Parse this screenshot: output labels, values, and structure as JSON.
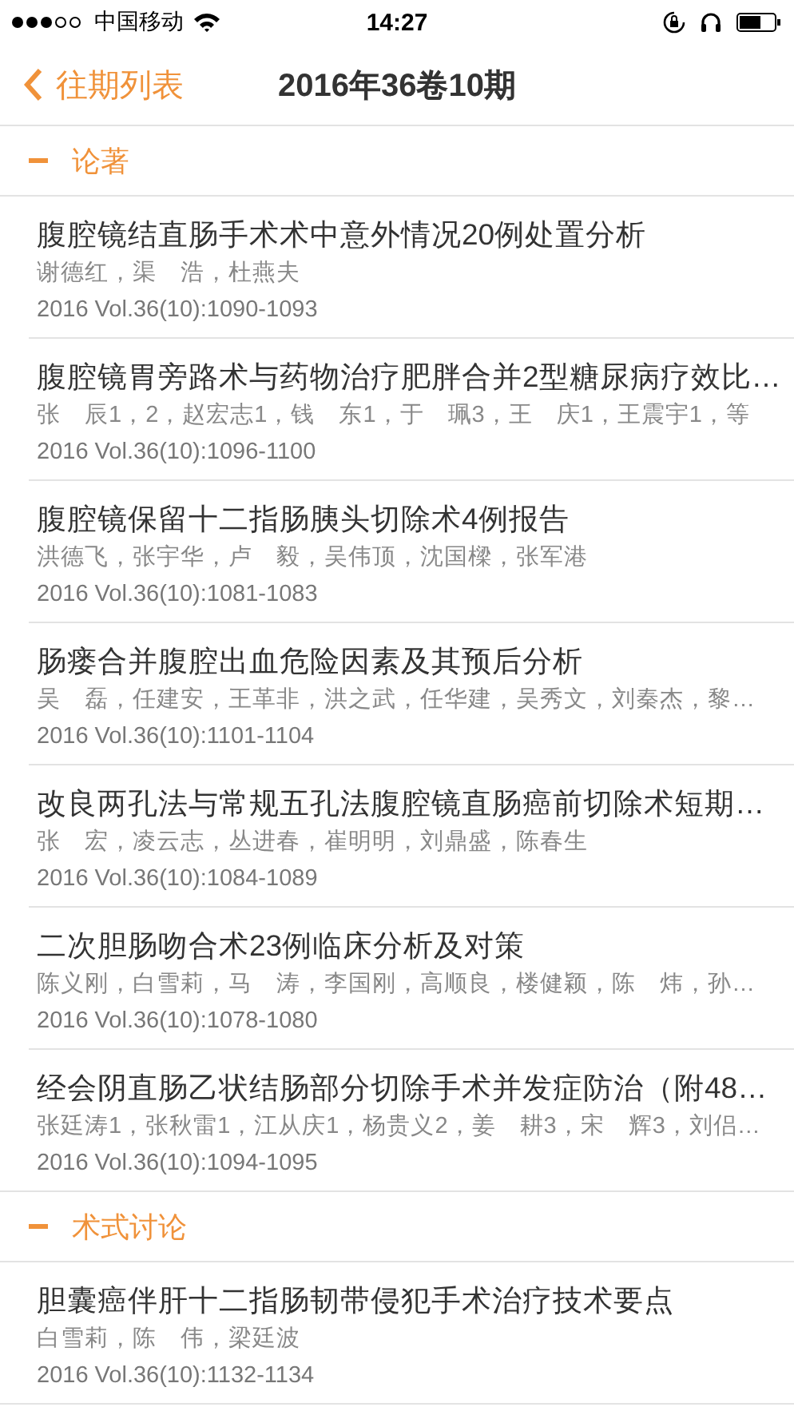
{
  "status_bar": {
    "carrier": "中国移动",
    "time": "14:27"
  },
  "nav": {
    "back": "往期列表",
    "title": "2016年36卷10期"
  },
  "sections": [
    {
      "title": "论著",
      "expanded": true,
      "articles": [
        {
          "title": "腹腔镜结直肠手术术中意外情况20例处置分析",
          "authors": "谢德红，渠　浩，杜燕夫",
          "citation": "2016 Vol.36(10):1090-1093"
        },
        {
          "title": "腹腔镜胃旁路术与药物治疗肥胖合并2型糖尿病疗效比…",
          "authors": "张　辰1，2，赵宏志1，钱　东1，于　珮3，王　庆1，王震宇1，等",
          "citation": "2016 Vol.36(10):1096-1100"
        },
        {
          "title": "腹腔镜保留十二指肠胰头切除术4例报告",
          "authors": "洪德飞，张宇华，卢　毅，吴伟顶，沈国樑，张军港",
          "citation": "2016 Vol.36(10):1081-1083"
        },
        {
          "title": "肠瘘合并腹腔出血危险因素及其预后分析",
          "authors": "吴　磊，任建安，王革非，洪之武，任华建，吴秀文，刘秦杰，黎…",
          "citation": "2016 Vol.36(10):1101-1104"
        },
        {
          "title": "改良两孔法与常规五孔法腹腔镜直肠癌前切除术短期…",
          "authors": "张　宏，凌云志，丛进春，崔明明，刘鼎盛，陈春生",
          "citation": "2016 Vol.36(10):1084-1089"
        },
        {
          "title": "二次胆肠吻合术23例临床分析及对策",
          "authors": "陈义刚，白雪莉，马　涛，李国刚，高顺良，楼健颖，陈　炜，孙…",
          "citation": "2016 Vol.36(10):1078-1080"
        },
        {
          "title": "经会阴直肠乙状结肠部分切除手术并发症防治（附48…",
          "authors": "张廷涛1，张秋雷1，江从庆1，杨贵义2，姜　耕3，宋　辉3，刘侣…",
          "citation": "2016 Vol.36(10):1094-1095"
        }
      ]
    },
    {
      "title": "术式讨论",
      "expanded": true,
      "articles": [
        {
          "title": "胆囊癌伴肝十二指肠韧带侵犯手术治疗技术要点",
          "authors": "白雪莉，陈　伟，梁廷波",
          "citation": "2016 Vol.36(10):1132-1134"
        }
      ]
    }
  ]
}
